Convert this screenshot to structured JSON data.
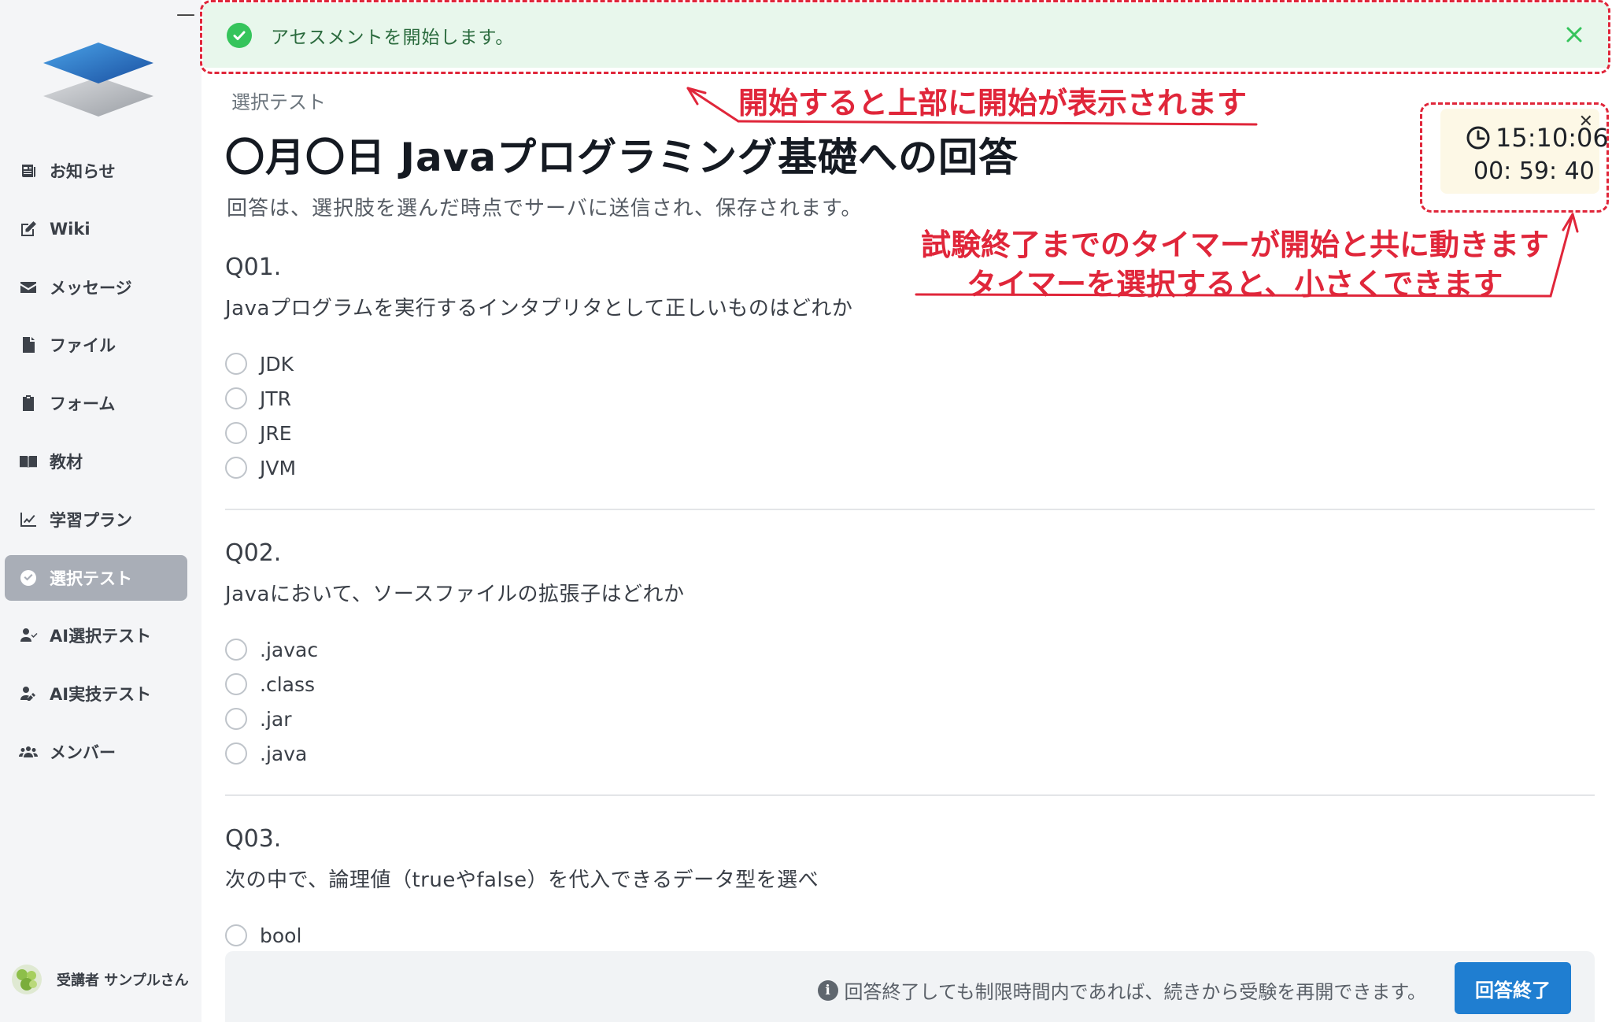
{
  "alert": {
    "message": "アセスメントを開始します。"
  },
  "sidebar": {
    "items": [
      {
        "label": "お知らせ",
        "icon": "newspaper-icon"
      },
      {
        "label": "Wiki",
        "icon": "edit-icon"
      },
      {
        "label": "メッセージ",
        "icon": "envelope-icon"
      },
      {
        "label": "ファイル",
        "icon": "file-icon"
      },
      {
        "label": "フォーム",
        "icon": "clipboard-icon"
      },
      {
        "label": "教材",
        "icon": "book-icon"
      },
      {
        "label": "学習プラン",
        "icon": "chart-line-icon"
      },
      {
        "label": "選択テスト",
        "icon": "check-circle-icon",
        "active": true
      },
      {
        "label": "AI選択テスト",
        "icon": "user-check-icon"
      },
      {
        "label": "AI実技テスト",
        "icon": "user-edit-icon"
      },
      {
        "label": "メンバー",
        "icon": "users-icon"
      }
    ],
    "user": {
      "name": "受講者 サンプルさん"
    }
  },
  "main": {
    "breadcrumb": "選択テスト",
    "title": "〇月〇日 Javaプログラミング基礎への回答",
    "subtitle": "回答は、選択肢を選んだ時点でサーバに送信され、保存されます。",
    "questions": [
      {
        "number": "Q01.",
        "text": "Javaプログラムを実行するインタプリタとして正しいものはどれか",
        "options": [
          "JDK",
          "JTR",
          "JRE",
          "JVM"
        ]
      },
      {
        "number": "Q02.",
        "text": "Javaにおいて、ソースファイルの拡張子はどれか",
        "options": [
          ".javac",
          ".class",
          ".jar",
          ".java"
        ]
      },
      {
        "number": "Q03.",
        "text": "次の中で、論理値（trueやfalse）を代入できるデータ型を選べ",
        "options": [
          "bool"
        ]
      }
    ]
  },
  "timer": {
    "clock": "15:10:06",
    "remaining": "00: 59: 40"
  },
  "footer": {
    "note": "回答終了しても制限時間内であれば、続きから受験を再開できます。",
    "finish_label": "回答終了"
  },
  "annotations": {
    "top": "開始すると上部に開始が表示されます",
    "timer_line1": "試験終了までのタイマーが開始と共に動きます",
    "timer_line2": "タイマーを選択すると、小さくできます"
  },
  "colors": {
    "accent": "#1f7ed1",
    "annotation": "#e0263a",
    "success": "#35c45b",
    "sidebar_active": "#a9aeb7"
  }
}
